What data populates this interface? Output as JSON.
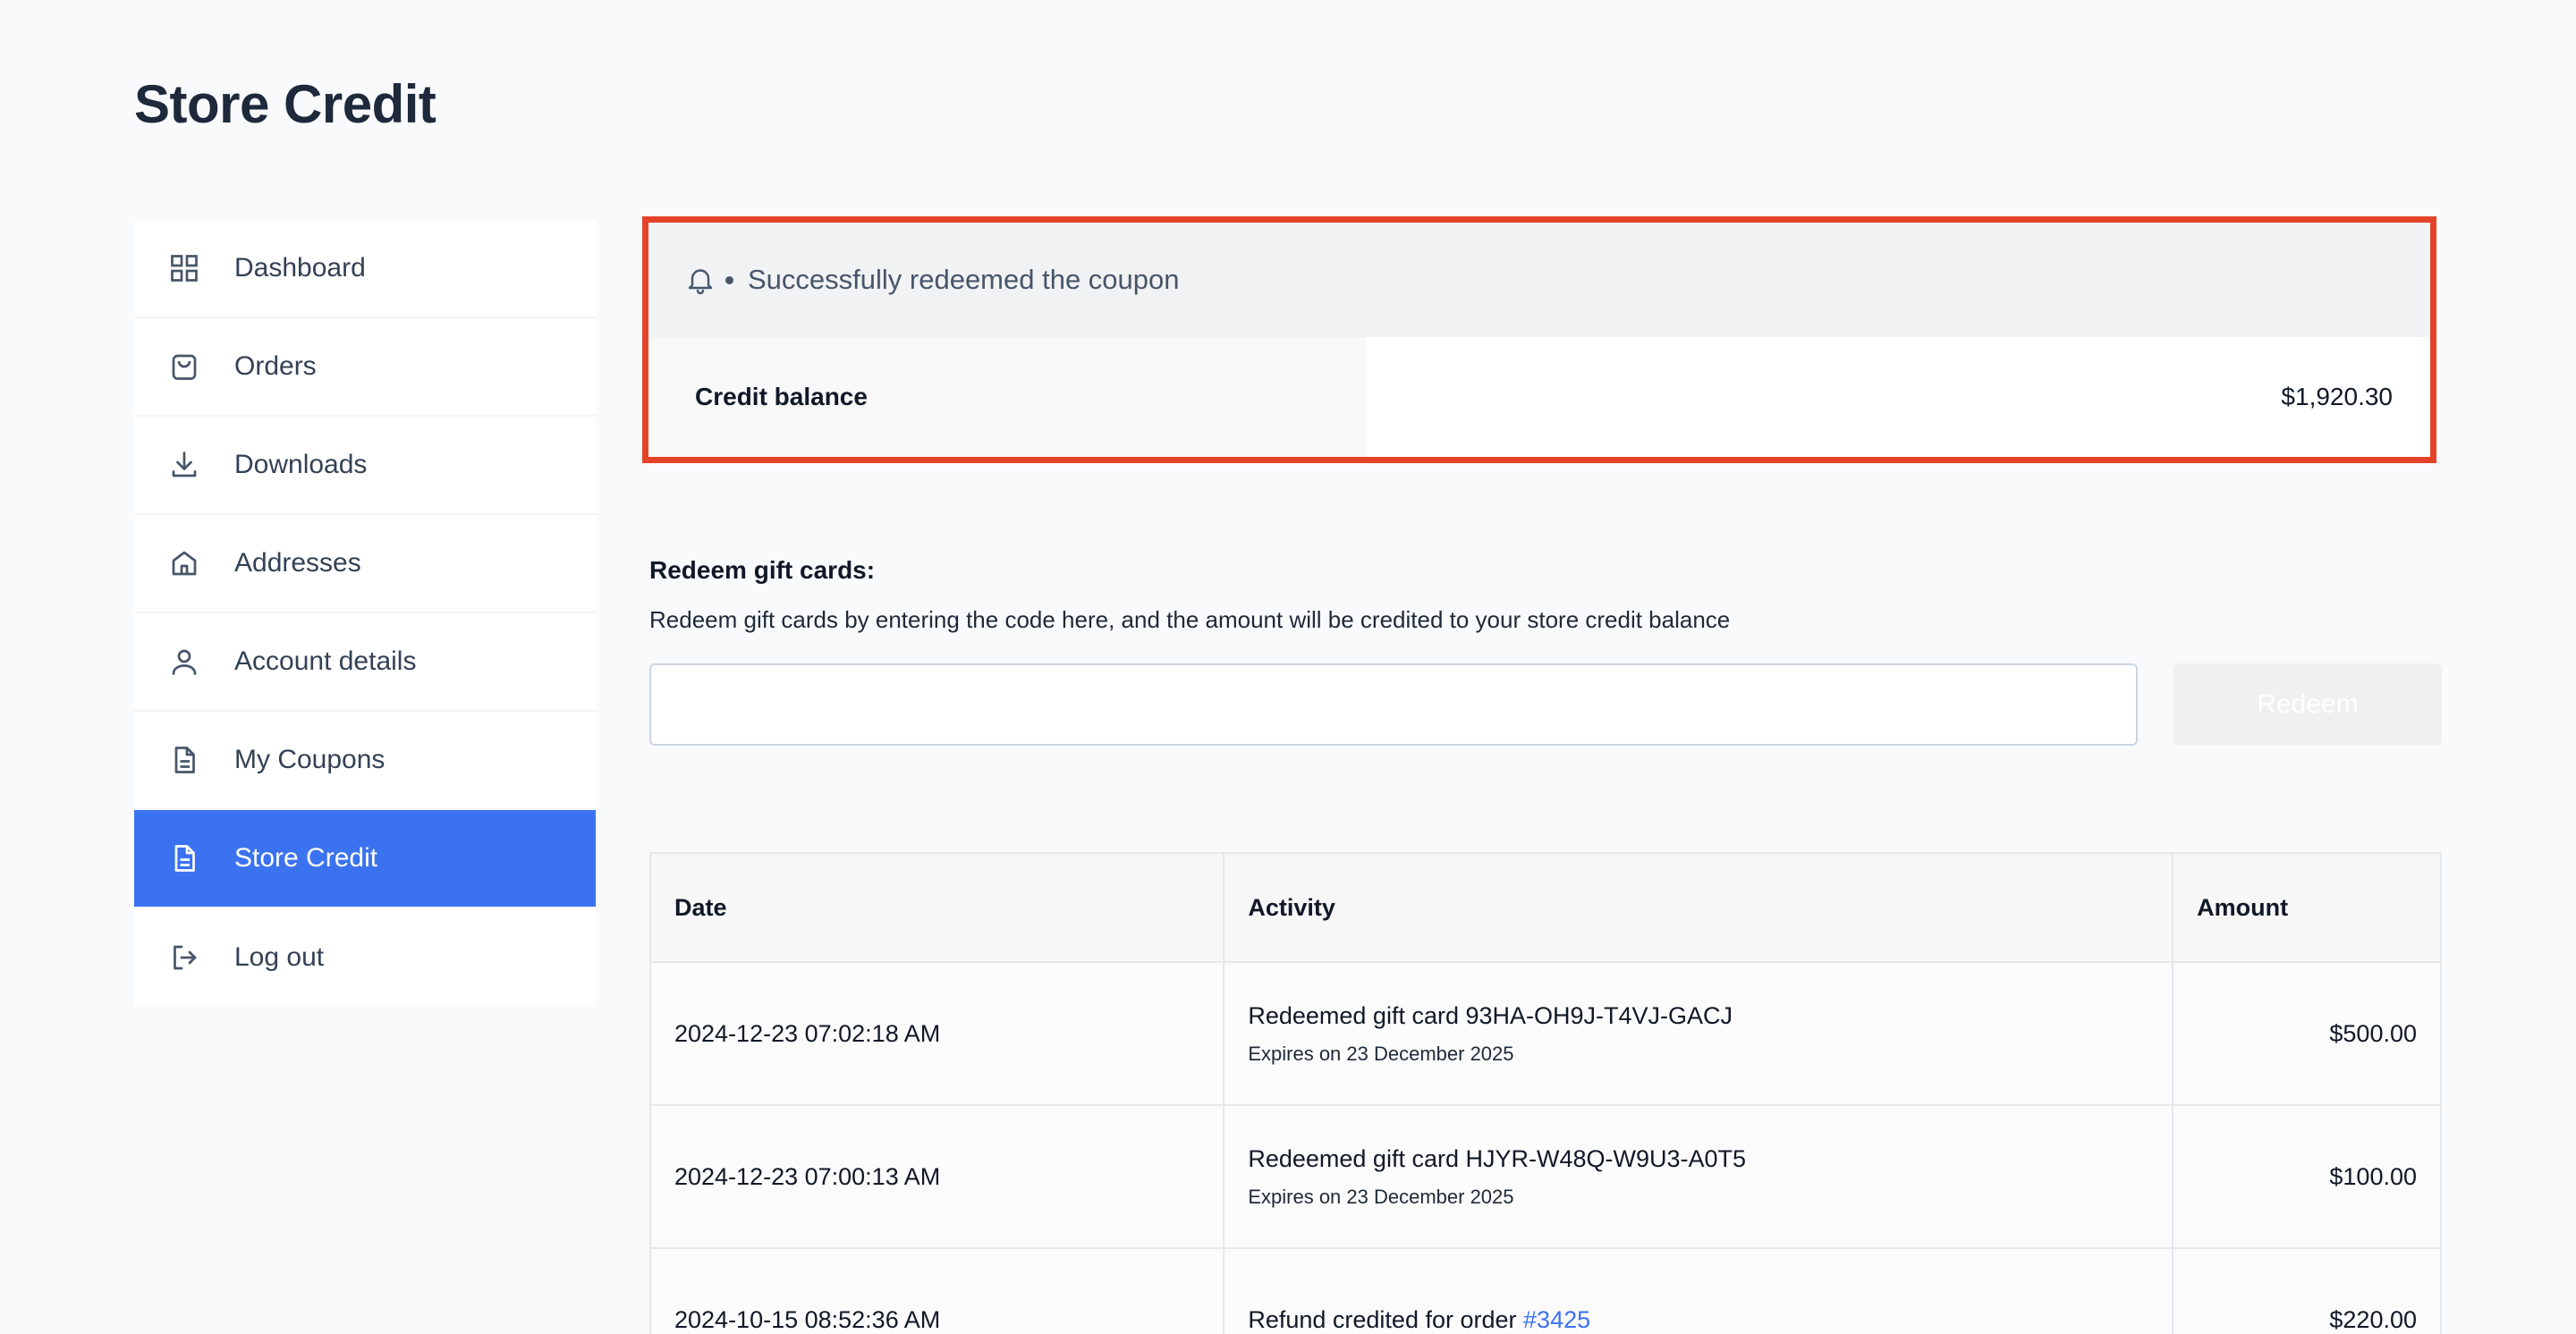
{
  "page": {
    "title": "Store Credit"
  },
  "sidebar": {
    "items": [
      {
        "label": "Dashboard",
        "icon": "grid-icon",
        "active": false
      },
      {
        "label": "Orders",
        "icon": "bag-icon",
        "active": false
      },
      {
        "label": "Downloads",
        "icon": "download-icon",
        "active": false
      },
      {
        "label": "Addresses",
        "icon": "home-icon",
        "active": false
      },
      {
        "label": "Account details",
        "icon": "user-icon",
        "active": false
      },
      {
        "label": "My Coupons",
        "icon": "document-icon",
        "active": false
      },
      {
        "label": "Store Credit",
        "icon": "document-icon",
        "active": true
      },
      {
        "label": "Log out",
        "icon": "logout-icon",
        "active": false
      }
    ]
  },
  "notice": {
    "message": "Successfully redeemed the coupon",
    "icon": "bell-icon"
  },
  "balance": {
    "label": "Credit balance",
    "value": "$1,920.30"
  },
  "redeem": {
    "title": "Redeem gift cards:",
    "description": "Redeem gift cards by entering the code here, and the amount will be credited to your store credit balance",
    "input_value": "",
    "button_label": "Redeem"
  },
  "history": {
    "columns": [
      "Date",
      "Activity",
      "Amount"
    ],
    "rows": [
      {
        "date": "2024-12-23 07:02:18 AM",
        "activity": "Redeemed gift card 93HA-OH9J-T4VJ-GACJ",
        "sub": "Expires on 23 December 2025",
        "amount": "$500.00"
      },
      {
        "date": "2024-12-23 07:00:13 AM",
        "activity": "Redeemed gift card HJYR-W48Q-W9U3-A0T5",
        "sub": "Expires on 23 December 2025",
        "amount": "$100.00"
      },
      {
        "date": "2024-10-15 08:52:36 AM",
        "activity": "Refund credited for order",
        "link": "#3425",
        "amount": "$220.00"
      }
    ]
  },
  "colors": {
    "accent": "#3b72f0",
    "highlight": "#e4432a"
  }
}
